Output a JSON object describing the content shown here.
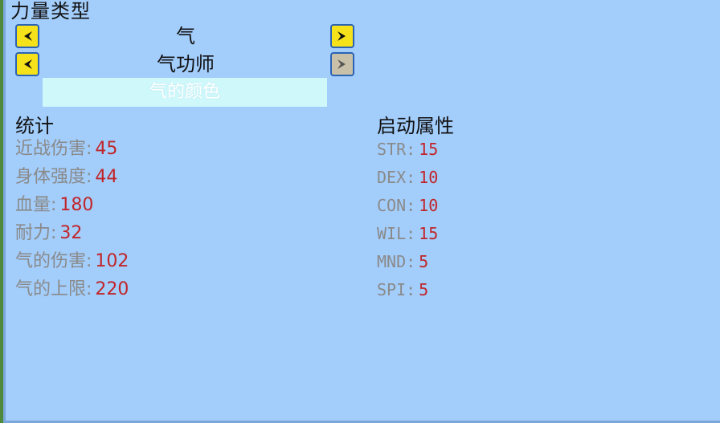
{
  "title": "力量类型",
  "selectors": [
    {
      "label": "气",
      "right_enabled": true
    },
    {
      "label": "气功师",
      "right_enabled": false
    }
  ],
  "color_button": "气的颜色",
  "stats": {
    "heading": "统计",
    "items": [
      {
        "key": "近战伤害:",
        "value": "45"
      },
      {
        "key": "身体强度:",
        "value": "44"
      },
      {
        "key": "血量:",
        "value": "180"
      },
      {
        "key": "耐力:",
        "value": "32"
      },
      {
        "key": "气的伤害:",
        "value": "102"
      },
      {
        "key": "气的上限:",
        "value": "220"
      }
    ]
  },
  "attributes": {
    "heading": "启动属性",
    "items": [
      {
        "key": "STR:",
        "value": "15"
      },
      {
        "key": "DEX:",
        "value": "10"
      },
      {
        "key": "CON:",
        "value": "10"
      },
      {
        "key": "WIL:",
        "value": "15"
      },
      {
        "key": "MND:",
        "value": "5"
      },
      {
        "key": "SPI:",
        "value": "5"
      }
    ]
  },
  "colors": {
    "panel": "#a3cdfb",
    "arrow_button": "#f6e21a",
    "value_text": "#c0262a",
    "key_text": "#8a8a8a"
  }
}
